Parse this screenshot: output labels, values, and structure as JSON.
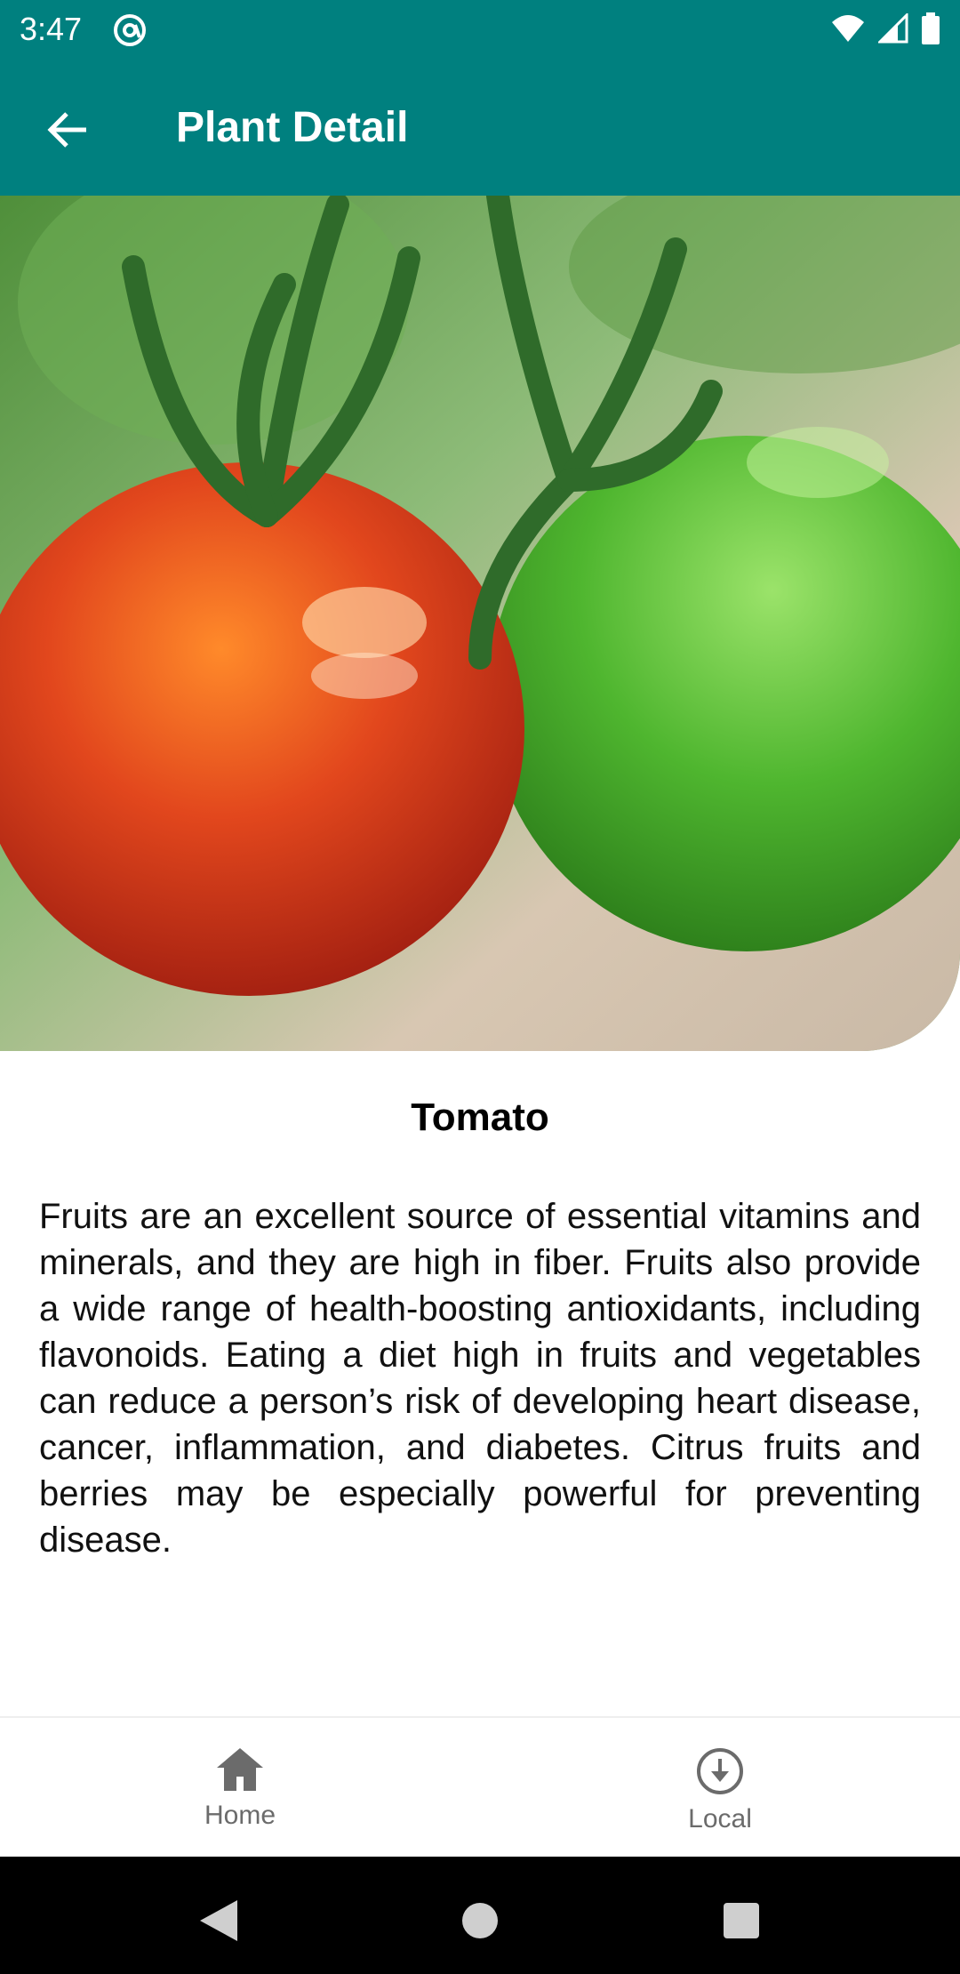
{
  "status_bar": {
    "time": "3:47",
    "icons": [
      "app-notification-icon",
      "wifi-icon",
      "signal-icon",
      "battery-icon"
    ]
  },
  "app_bar": {
    "title": "Plant Detail",
    "back_icon": "arrow-back-icon"
  },
  "plant": {
    "name": "Tomato",
    "description": "Fruits are an excellent source of essential vitamins and minerals, and they are high in fiber. Fruits also provide a wide range of health-boosting antioxidants, including flavonoids. Eating a diet high in fruits and vegetables can reduce a person’s risk of developing heart disease, cancer, inflammation, and diabetes. Citrus fruits and berries may be especially powerful for preventing disease.",
    "image": "tomato-photo"
  },
  "bottom_nav": {
    "items": [
      {
        "label": "Home",
        "icon": "home-icon"
      },
      {
        "label": "Local",
        "icon": "download-circle-icon"
      }
    ]
  },
  "colors": {
    "primary": "#00807f",
    "nav_text": "#6b6b6b"
  }
}
